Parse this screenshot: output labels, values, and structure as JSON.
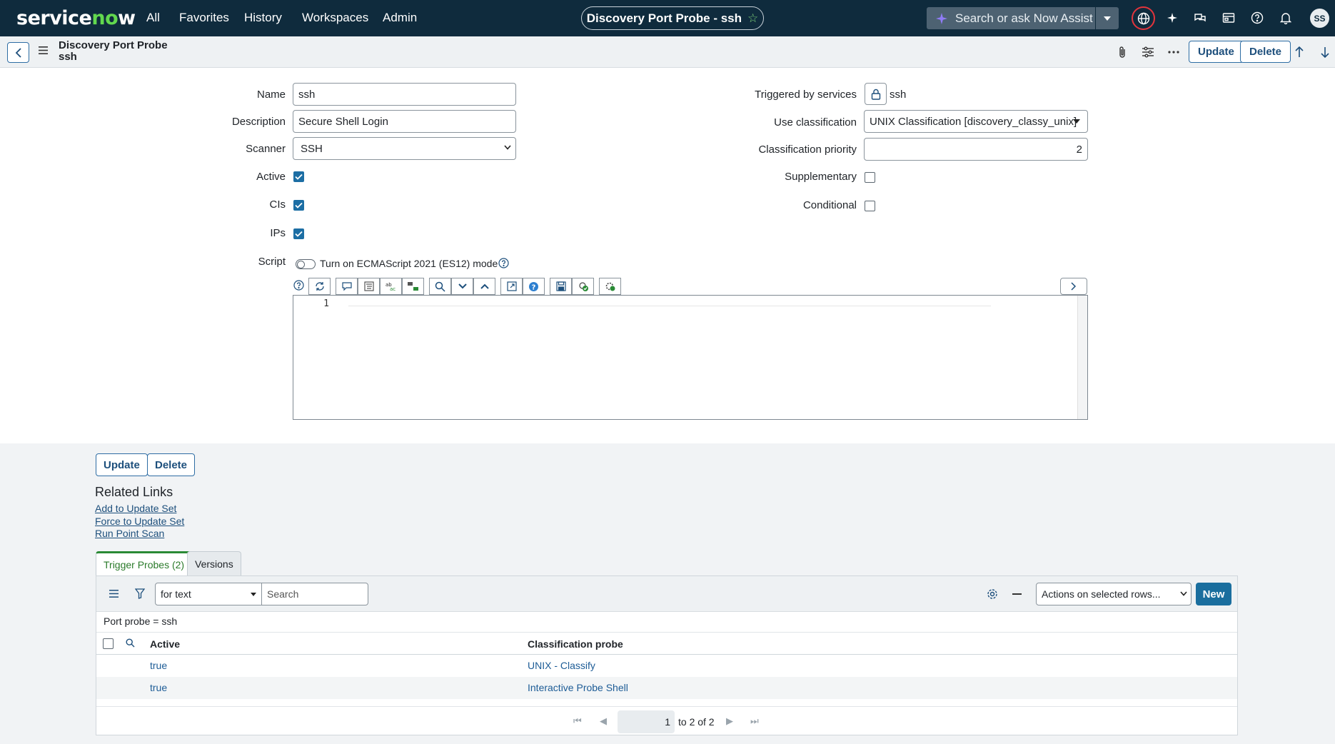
{
  "app": {
    "logo": "servicenow",
    "nav": [
      "All",
      "Favorites",
      "History",
      "Workspaces",
      "Admin"
    ],
    "title": "Discovery Port Probe - ssh",
    "search_placeholder": "Search or ask Now Assist",
    "avatar_initials": "SS"
  },
  "header": {
    "record_type": "Discovery Port Probe",
    "record_name": "ssh",
    "update_label": "Update",
    "delete_label": "Delete"
  },
  "form": {
    "name_label": "Name",
    "name_value": "ssh",
    "description_label": "Description",
    "description_value": "Secure Shell Login",
    "scanner_label": "Scanner",
    "scanner_value": "SSH",
    "active_label": "Active",
    "active_checked": true,
    "cis_label": "CIs",
    "cis_checked": true,
    "ips_label": "IPs",
    "ips_checked": true,
    "triggered_label": "Triggered by services",
    "triggered_value": "ssh",
    "use_classification_label": "Use classification",
    "use_classification_value": "UNIX Classification [discovery_classy_unix]",
    "classification_priority_label": "Classification priority",
    "classification_priority_value": "2",
    "supplementary_label": "Supplementary",
    "supplementary_checked": false,
    "conditional_label": "Conditional",
    "conditional_checked": false,
    "script_label": "Script",
    "es12_label": "Turn on ECMAScript 2021 (ES12) mode",
    "es12_on": false,
    "line_number": "1"
  },
  "lower": {
    "update_label": "Update",
    "delete_label": "Delete",
    "related_links_title": "Related Links",
    "related_links": [
      "Add to Update Set",
      "Force to Update Set",
      "Run Point Scan"
    ]
  },
  "tabs": {
    "trigger_probes": "Trigger Probes (2)",
    "versions": "Versions"
  },
  "list": {
    "search_field": "for text",
    "search_placeholder": "Search",
    "actions_label": "Actions on selected rows...",
    "new_label": "New",
    "filter_text": "Port probe = ssh",
    "columns": [
      "Active",
      "Classification probe"
    ],
    "rows": [
      {
        "active": "true",
        "classification_probe": "UNIX - Classify"
      },
      {
        "active": "true",
        "classification_probe": "Interactive Probe Shell"
      }
    ],
    "pager_value": "1",
    "pager_text": "to 2 of 2"
  },
  "colors": {
    "nav_bg": "#0f2b3d",
    "accent": "#1a6e9e",
    "link": "#1d5c96",
    "tab_active": "#2a8a35"
  }
}
